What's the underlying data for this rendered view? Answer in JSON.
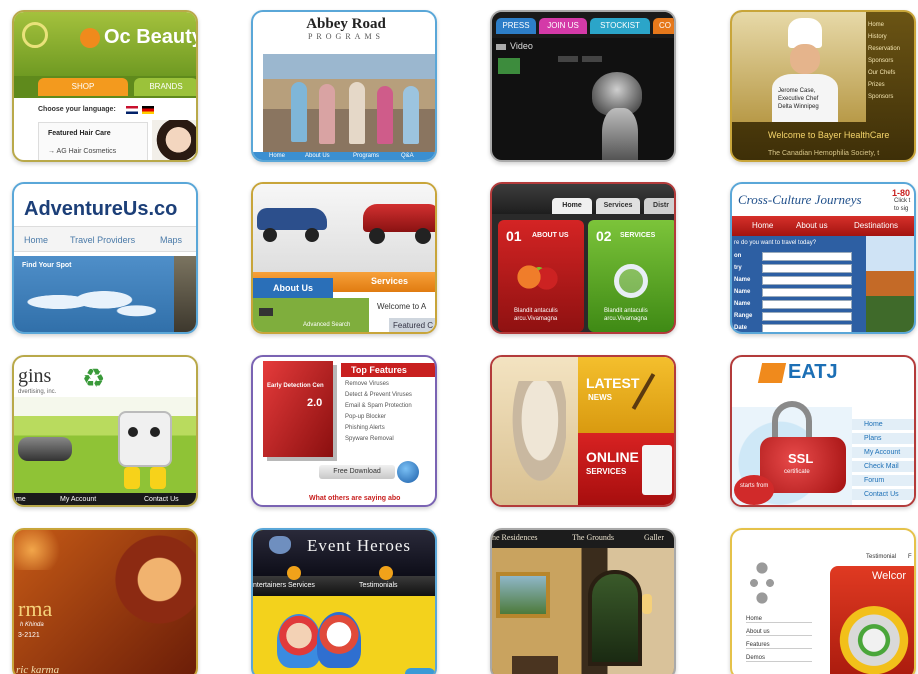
{
  "tiles": {
    "beauty": {
      "logo": "Oc Beauty",
      "tab_shop": "SHOP",
      "tab_brands": "BRANDS",
      "language_label": "Choose your language:",
      "featured": "Featured Hair Care",
      "link": "→ AG Hair Cosmetics"
    },
    "abbey": {
      "title": "Abbey Road",
      "subtitle": "PROGRAMS",
      "nav": [
        "Home",
        "About Us",
        "Programs",
        "Q&A"
      ]
    },
    "video": {
      "tabs": [
        "PRESS",
        "JOIN US",
        "STOCKIST",
        "CO"
      ],
      "label": "Video"
    },
    "chef": {
      "menu": [
        "Home",
        "History",
        "Reservation",
        "Sponsors",
        "Our Chefs",
        "Prizes",
        "Sponsors"
      ],
      "caption": [
        "Jerome Case,",
        "Executive Chef",
        "Delta Winnipeg"
      ],
      "welcome": "Welcome to Bayer HealthCare",
      "society": "The Canadian Hemophilia Society, t"
    },
    "adventure": {
      "logo": "AdventureUs.co",
      "nav": [
        "Home",
        "Travel Providers",
        "Maps"
      ],
      "find": "Find Your Spot"
    },
    "cars": {
      "about": "About Us",
      "services": "Services",
      "welcome": "Welcome to A",
      "search": "Advanced Search",
      "featured": "Featured C"
    },
    "clinic": {
      "tabs": [
        "Home",
        "Services",
        "Distr"
      ],
      "box1_num": "01",
      "box1_title": "ABOUT US",
      "box2_num": "02",
      "box2_title": "SERVICES",
      "box1_text": [
        "Blandit antaculis",
        "arcu.Vivamagna"
      ],
      "box2_text": [
        "Blandit antaculis",
        "arcu.Vivamagna"
      ]
    },
    "cross": {
      "logo": "Cross-Culture Journeys",
      "corner": "1-80",
      "corner2": "Click t",
      "corner3": "to sig",
      "nav": [
        "Home",
        "About us",
        "Destinations"
      ],
      "question": "re do you want to travel today?",
      "fields": [
        "on",
        "try",
        "Name",
        "Name",
        "Name",
        "Range",
        "Date"
      ]
    },
    "gins": {
      "logo": "gins",
      "sub": "dvertising, inc.",
      "nav": [
        "me",
        "My Account",
        "Contact Us"
      ]
    },
    "detect": {
      "box_brand": "Early Detection Cen",
      "box_version": "2.0",
      "heading": "Top Features",
      "features": [
        "Remove Viruses",
        "Detect & Prevent Viruses",
        "Email & Spam Protection",
        "Pop-up Blocker",
        "Phishing Alerts",
        "Spyware Removal"
      ],
      "download": "Free Download",
      "footer": "What others are saying abo"
    },
    "news": {
      "latest": "LATEST",
      "news": "NEWS",
      "online": "ONLINE",
      "services": "SERVICES"
    },
    "eatj": {
      "logo": "EATJ",
      "badge": "SSL",
      "badge_sub": "certificate",
      "starts": "starts from",
      "menu": [
        "Home",
        "Plans",
        "My Account",
        "Check Mail",
        "Forum",
        "Contact Us"
      ]
    },
    "karma": {
      "title": "rma",
      "line1": "h Khinda",
      "line2": "3-2121",
      "footer": "ric karma"
    },
    "event": {
      "logo": "Event Heroes",
      "nav": [
        "ntertainers Services",
        "Testimonials"
      ]
    },
    "residence": {
      "nav": [
        "he Residences",
        "The Grounds",
        "Galler"
      ]
    },
    "testimonial": {
      "top": "Testimonial",
      "top2": "F",
      "welcome": "Welcor",
      "menu": [
        "Home",
        "About us",
        "Features",
        "Demos"
      ]
    }
  },
  "colors": {
    "olive": "#8fb33b",
    "orange": "#f39a1e",
    "navy": "#1f5a96",
    "red": "#c8201f",
    "green": "#7cbf2d",
    "gold": "#c99a1b"
  }
}
